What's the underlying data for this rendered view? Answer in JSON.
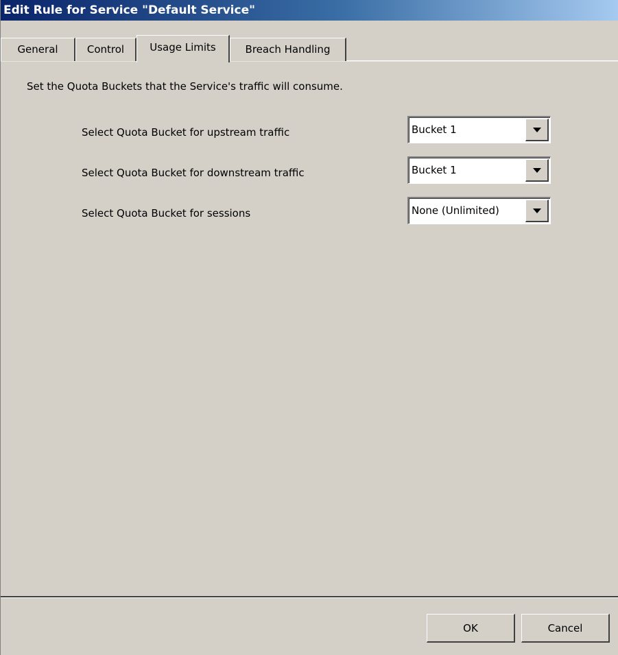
{
  "window": {
    "title": "Edit Rule for Service \"Default Service\""
  },
  "tabs": [
    {
      "label": "General",
      "active": false
    },
    {
      "label": "Control",
      "active": false
    },
    {
      "label": "Usage Limits",
      "active": true
    },
    {
      "label": "Breach Handling",
      "active": false
    }
  ],
  "content": {
    "description": "Set the Quota Buckets that the Service's traffic will consume.",
    "rows": [
      {
        "label": "Select Quota Bucket for upstream traffic",
        "value": "Bucket 1"
      },
      {
        "label": "Select Quota Bucket for downstream traffic",
        "value": "Bucket 1"
      },
      {
        "label": "Select Quota Bucket for sessions",
        "value": "None (Unlimited)"
      }
    ]
  },
  "buttons": {
    "ok": "OK",
    "cancel": "Cancel"
  },
  "colors": {
    "dialog_background": "#d4d0c8",
    "title_bar_start": "#0a246a",
    "title_bar_end": "#a6caf0",
    "title_text": "#ffffff"
  },
  "icons": {
    "dropdown": "chevron-down-icon"
  }
}
